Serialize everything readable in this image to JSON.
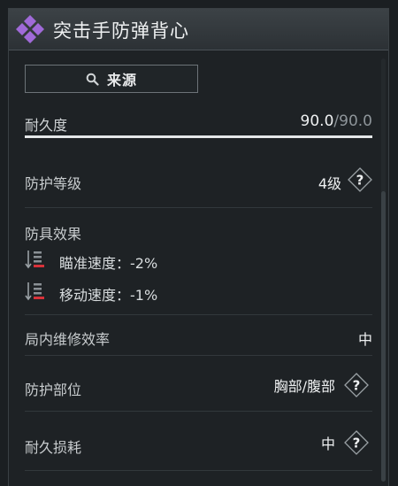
{
  "title": "突击手防弹背心",
  "source_button": {
    "label": "来源"
  },
  "durability": {
    "label": "耐久度",
    "current": "90.0",
    "separator": "/",
    "max": "90.0",
    "fill_fraction": 1.0
  },
  "protection_level": {
    "label": "防护等级",
    "value": "4级"
  },
  "armor_effects": {
    "label": "防具效果",
    "items": [
      {
        "text": "瞄准速度：-2%"
      },
      {
        "text": "移动速度：-1%"
      }
    ]
  },
  "repair_efficiency": {
    "label": "局内维修效率",
    "value": "中"
  },
  "protected_area": {
    "label": "防护部位",
    "value": "胸部/腹部"
  },
  "durability_loss": {
    "label": "耐久损耗",
    "value": "中"
  },
  "icons": {
    "title": "purple-diamond-cluster-icon",
    "search": "magnifier-icon",
    "help": "question-diamond-icon",
    "effect": "down-bars-red-icon"
  },
  "colors": {
    "accent": "#a06ad8",
    "negative": "#d8323a"
  }
}
